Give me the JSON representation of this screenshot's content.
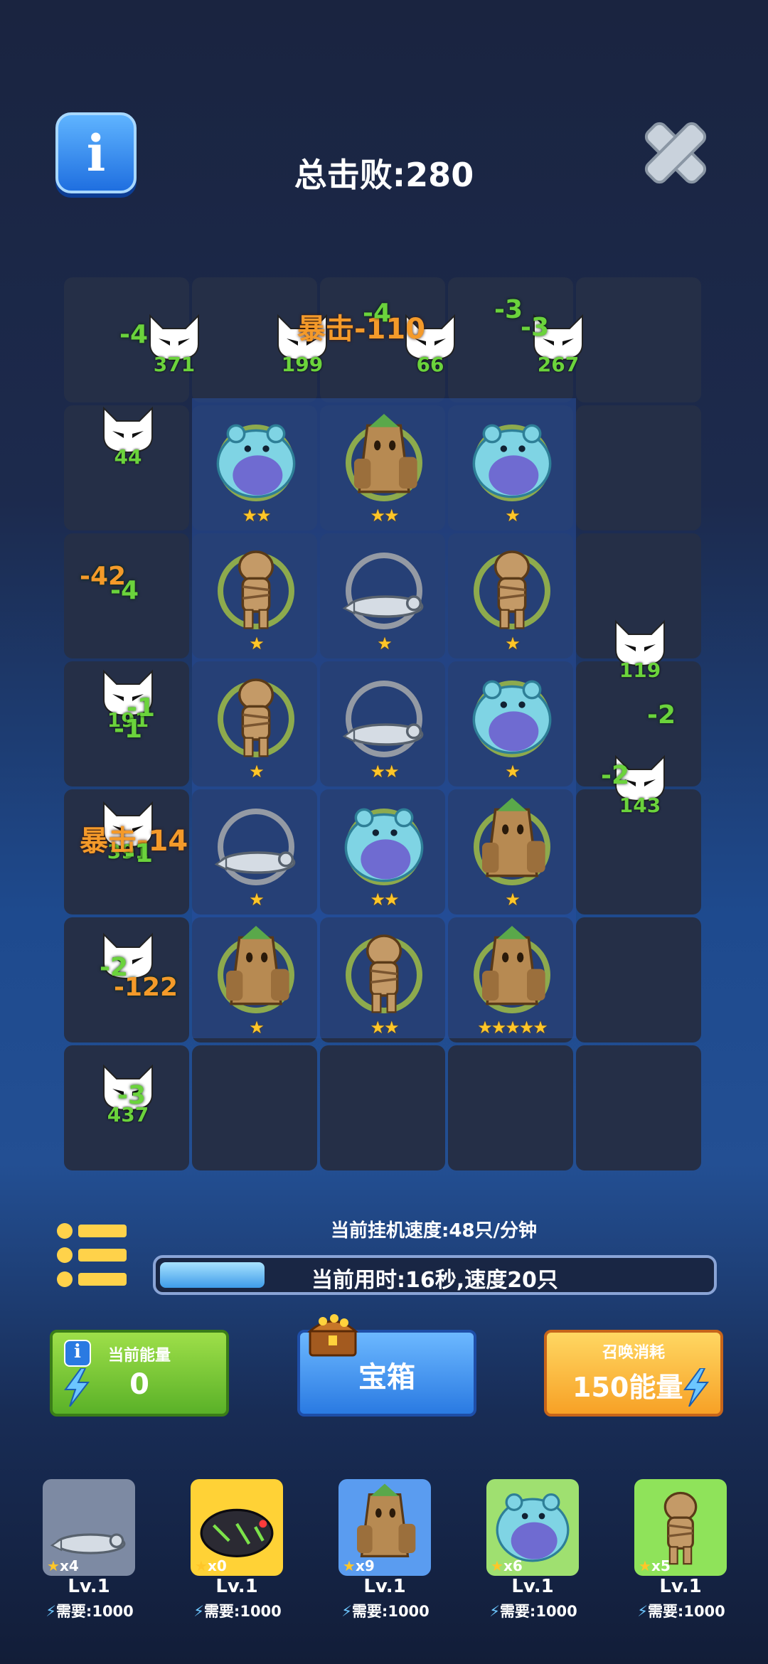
{
  "header": {
    "title": "总击败:280"
  },
  "enemies": [
    {
      "hp": "371"
    },
    {
      "hp": "199"
    },
    {
      "hp": "66"
    },
    {
      "hp": "267"
    },
    {
      "hp": "44"
    },
    {
      "hp": "119"
    },
    {
      "hp": "191"
    },
    {
      "hp": "143"
    },
    {
      "hp": "391"
    },
    {
      "hp": "",
      "note": ""
    },
    {
      "hp": "437"
    }
  ],
  "damage_texts": [
    "-4",
    "暴击-110",
    "-4",
    "-3",
    "-3",
    "-42",
    "-4",
    "-1",
    "-1",
    "-2",
    "-2",
    "暴击-14",
    "-1",
    "-2",
    "-122",
    "-3"
  ],
  "units": [
    {
      "kind": "yeti",
      "stars": "★★"
    },
    {
      "kind": "treant",
      "stars": "★★"
    },
    {
      "kind": "yeti",
      "stars": "★"
    },
    {
      "kind": "mummy",
      "stars": "★"
    },
    {
      "kind": "lizard",
      "stars": "★"
    },
    {
      "kind": "mummy",
      "stars": "★"
    },
    {
      "kind": "mummy",
      "stars": "★"
    },
    {
      "kind": "lizard",
      "stars": "★★"
    },
    {
      "kind": "yeti",
      "stars": "★"
    },
    {
      "kind": "lizard",
      "stars": "★"
    },
    {
      "kind": "yeti",
      "stars": "★★"
    },
    {
      "kind": "treant",
      "stars": "★"
    },
    {
      "kind": "treant",
      "stars": "★"
    },
    {
      "kind": "mummy",
      "stars": "★★"
    },
    {
      "kind": "treant",
      "stars": "★★★★★"
    }
  ],
  "status": {
    "speed": "当前挂机速度:48只/分钟",
    "time": "当前用时:16秒,速度20只",
    "progress": 0.19
  },
  "cards": {
    "energy": {
      "label": "当前能量",
      "value": "0"
    },
    "chest": {
      "label": "宝箱"
    },
    "summon": {
      "label": "召唤消耗",
      "value": "150能量"
    }
  },
  "shop": [
    {
      "kind": "lizard",
      "count": "x4",
      "level": "Lv.1",
      "need": "需要:1000"
    },
    {
      "kind": "boar",
      "count": "x0",
      "level": "Lv.1",
      "need": "需要:1000"
    },
    {
      "kind": "treant",
      "count": "x9",
      "level": "Lv.1",
      "need": "需要:1000"
    },
    {
      "kind": "yeti",
      "count": "x6",
      "level": "Lv.1",
      "need": "需要:1000"
    },
    {
      "kind": "mummy",
      "count": "x5",
      "level": "Lv.1",
      "need": "需要:1000"
    }
  ],
  "colors": {
    "accent_green": "#6bd33c",
    "crit_orange": "#f49a2a",
    "star": "#ffc628"
  }
}
